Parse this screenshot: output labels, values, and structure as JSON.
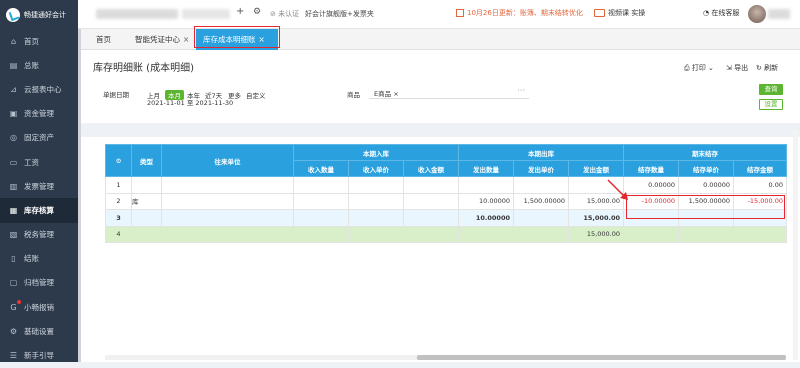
{
  "app": {
    "logo_text": "畅捷通好会计"
  },
  "topbar": {
    "add": "+",
    "settings_icon": "gear-icon",
    "auth_status": "未认证",
    "edition": "好会计旗舰版+发票夹",
    "notice": "10月26日更新：账簿、期末结转优化",
    "video": "视频课 实操",
    "service": "在线客服"
  },
  "sidebar": {
    "items": [
      {
        "label": "首页",
        "icon": "home-icon"
      },
      {
        "label": "总账",
        "icon": "ledger-icon"
      },
      {
        "label": "云报表中心",
        "icon": "report-icon"
      },
      {
        "label": "资金管理",
        "icon": "fund-icon"
      },
      {
        "label": "固定资产",
        "icon": "asset-icon"
      },
      {
        "label": "工资",
        "icon": "salary-icon"
      },
      {
        "label": "发票管理",
        "icon": "invoice-icon"
      },
      {
        "label": "库存核算",
        "icon": "inventory-icon",
        "active": true
      },
      {
        "label": "税务管理",
        "icon": "tax-icon"
      },
      {
        "label": "结账",
        "icon": "close-account-icon"
      },
      {
        "label": "归档管理",
        "icon": "archive-icon"
      },
      {
        "label": "小畅报销",
        "icon": "reimburse-icon",
        "badge": true
      },
      {
        "label": "基础设置",
        "icon": "setup-icon"
      },
      {
        "label": "新手引导",
        "icon": "guide-icon"
      }
    ]
  },
  "tabs": [
    {
      "label": "首页"
    },
    {
      "label": "智能凭证中心",
      "close": "×"
    },
    {
      "label": "库存成本明细账",
      "close": "×",
      "active": true
    }
  ],
  "page": {
    "title": "库存明细账 (成本明细)",
    "print": "打印",
    "export": "导出",
    "refresh": "刷新",
    "date_label": "单据日期",
    "ranges": [
      "上月",
      "本月",
      "本年",
      "近7天",
      "更多",
      "自定义"
    ],
    "active_range": "本月",
    "date_range": "2021-11-01 至 2021-11-30",
    "goods_label": "商品",
    "goods_tag": "E商品",
    "goods_more": "···",
    "query_button": "查询",
    "settings_button": "设置"
  },
  "table": {
    "groups": [
      "类型",
      "往来单位",
      "本期入库",
      "本期出库",
      "期末结存"
    ],
    "sub_headers": [
      "收入数量",
      "收入单价",
      "收入金额",
      "发出数量",
      "发出单价",
      "发出金额",
      "结存数量",
      "结存单价",
      "结存金额"
    ],
    "rows": [
      {
        "idx": "1",
        "type": "",
        "unit": "",
        "in_qty": "",
        "in_price": "",
        "in_amt": "",
        "out_qty": "",
        "out_price": "",
        "out_amt": "",
        "bal_qty": "0.00000",
        "bal_price": "0.00000",
        "bal_amt": "0.00"
      },
      {
        "idx": "2",
        "type": "库",
        "unit": "",
        "in_qty": "",
        "in_price": "",
        "in_amt": "",
        "out_qty": "10.00000",
        "out_price": "1,500.00000",
        "out_amt": "15,000.00",
        "bal_qty": "-10.00000",
        "bal_price": "1,500.00000",
        "bal_amt": "-15,000.00"
      },
      {
        "idx": "3",
        "type": "",
        "unit": "",
        "in_qty": "",
        "in_price": "",
        "in_amt": "",
        "out_qty": "10.00000",
        "out_price": "",
        "out_amt": "15,000.00",
        "bal_qty": "",
        "bal_price": "",
        "bal_amt": ""
      },
      {
        "idx": "4",
        "type": "",
        "unit": "",
        "in_qty": "",
        "in_price": "",
        "in_amt": "",
        "out_qty": "",
        "out_price": "",
        "out_amt": "15,000.00",
        "bal_qty": "",
        "bal_price": "",
        "bal_amt": ""
      }
    ]
  },
  "colors": {
    "accent": "#2aa0de",
    "sidebar": "#2d3a4b",
    "highlight": "#e3262f",
    "green": "#5bb531"
  }
}
